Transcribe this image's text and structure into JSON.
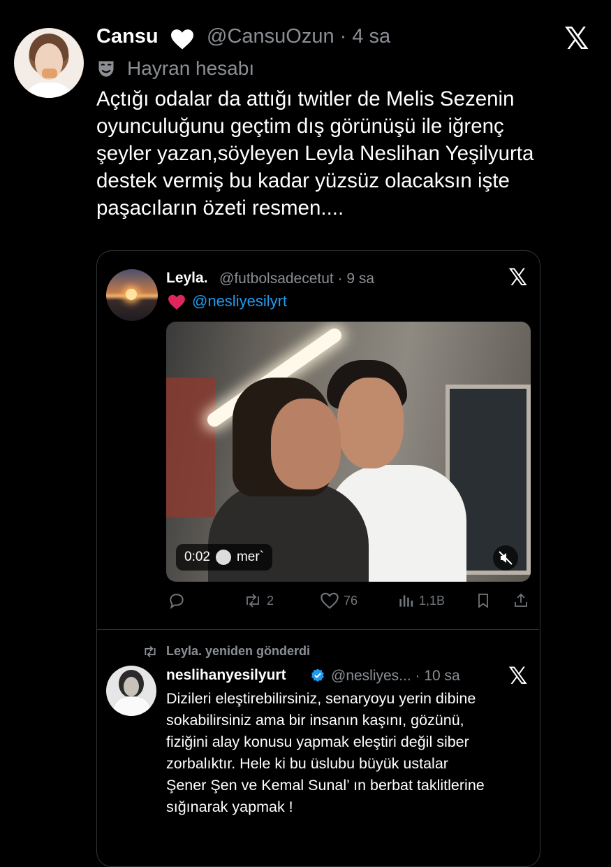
{
  "tweet": {
    "display_name": "Cansu",
    "handle_time": "@CansuOzun · 4 sa",
    "badge_label": "Hayran hesabı",
    "text": "Açtığı odalar da attığı twitler de Melis Sezenin\noyunculuğunu geçtim dış görünüşü ile iğrenç\nşeyler yazan,söyleyen Leyla Neslihan Yeşilyurta\ndestek vermiş bu kadar yüzsüz olacaksın işte\npaşacıların özeti resmen...."
  },
  "quoted": {
    "display_name": "Leyla.",
    "handle_time": "@futbolsadecetut · 9 sa",
    "mention": "@nesliyesilyrt",
    "video": {
      "time": "0:02",
      "caption": "mer`"
    },
    "actions": {
      "reply_count": "",
      "repost_count": "2",
      "like_count": "76",
      "views_count": "1,1B"
    }
  },
  "repost": {
    "label": "Leyla. yeniden gönderdi",
    "display_name": "neslihanyesilyurt",
    "handle_time": "@nesliyes... · 10 sa",
    "text": "Dizileri eleştirebilirsiniz, senaryoyu yerin dibine\nsokabilirsiniz ama bir insanın kaşını, gözünü,\nfiziğini alay konusu yapmak eleştiri değil siber\nzorbalıktır. Hele ki bu üslubu büyük ustalar\nŞener Şen ve Kemal Sunal’ ın berbat taklitlerine\nsığınarak yapmak !"
  },
  "icons": {
    "x_logo": "x-logo-icon",
    "heart": "white-heart-icon",
    "fan_badge": "theater-mask-icon",
    "red_heart": "red-heart-icon",
    "verified": "verified-badge-icon"
  },
  "colors": {
    "background": "#000000",
    "secondary_text": "#8b8f94",
    "link": "#1d9bf0",
    "border": "#333639"
  }
}
